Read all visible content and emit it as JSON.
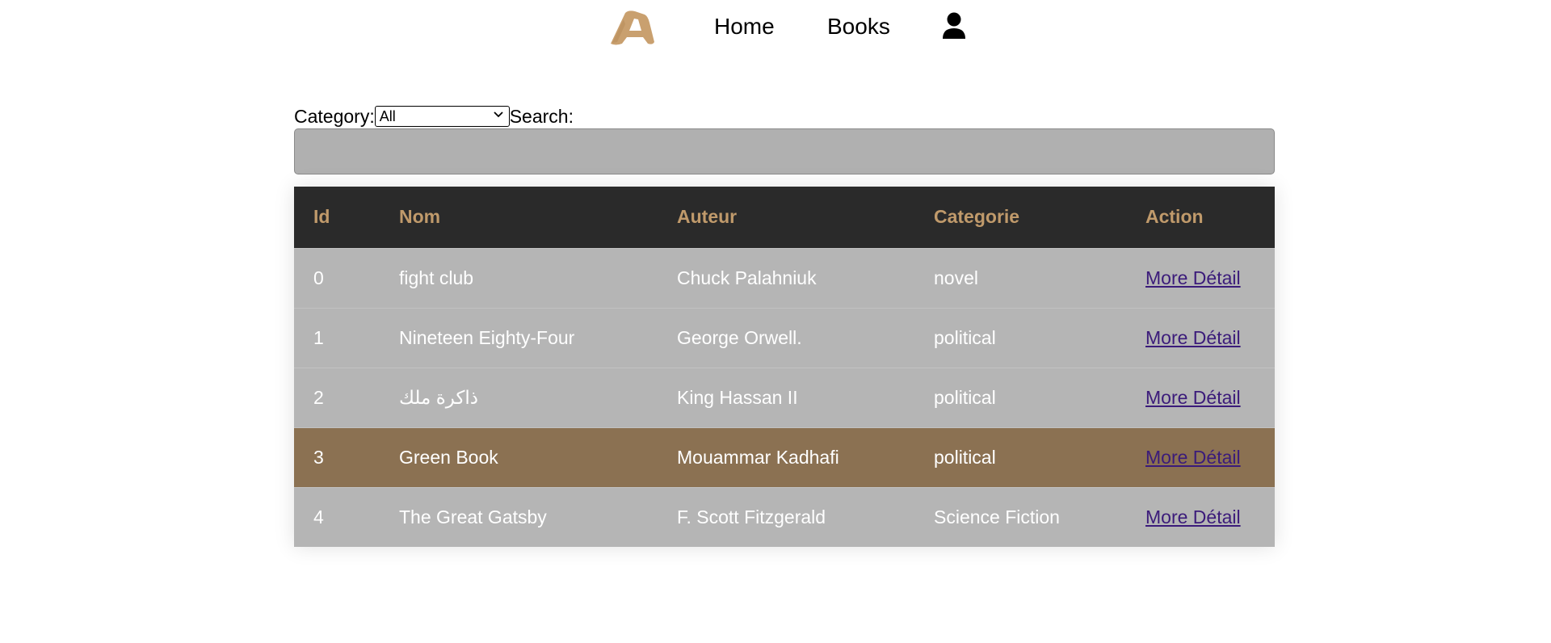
{
  "nav": {
    "home": "Home",
    "books": "Books",
    "logo_icon": "logo-a-icon",
    "user_icon": "user-icon"
  },
  "filters": {
    "category_label": "Category:",
    "category_selected": "All",
    "search_label": "Search:",
    "search_value": ""
  },
  "table": {
    "headers": [
      "Id",
      "Nom",
      "Auteur",
      "Categorie",
      "Action"
    ],
    "rows": [
      {
        "id": "0",
        "nom": "fight club",
        "auteur": "Chuck Palahniuk",
        "categorie": "novel",
        "action": "More Détail"
      },
      {
        "id": "1",
        "nom": "Nineteen Eighty-Four",
        "auteur": "George Orwell.",
        "categorie": "political",
        "action": "More Détail"
      },
      {
        "id": "2",
        "nom": "ذاكرة ملك",
        "auteur": "King Hassan II",
        "categorie": "political",
        "action": "More Détail"
      },
      {
        "id": "3",
        "nom": "Green Book",
        "auteur": "Mouammar Kadhafi",
        "categorie": "political",
        "action": "More Détail"
      },
      {
        "id": "4",
        "nom": "The Great Gatsby",
        "auteur": "F. Scott Fitzgerald",
        "categorie": "Science Fiction",
        "action": "More Détail"
      }
    ]
  },
  "colors": {
    "header_bg": "#2a2a2a",
    "header_text": "#c09a6b",
    "row_bg": "#b5b5b5",
    "highlight_bg": "#8b7152",
    "link": "#3b1b7a",
    "logo": "#c9a06f"
  }
}
